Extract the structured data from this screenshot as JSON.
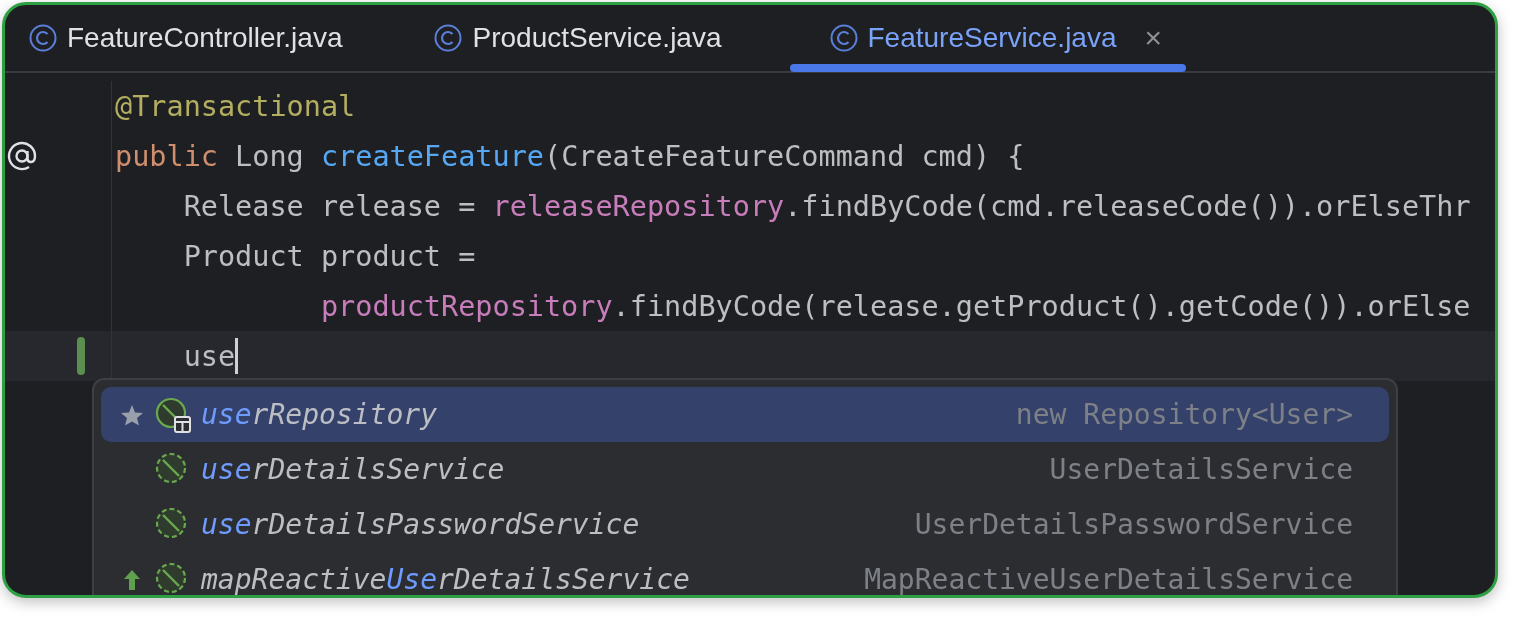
{
  "tabs": [
    {
      "label": "FeatureController.java",
      "selected": false
    },
    {
      "label": "ProductService.java",
      "selected": false
    },
    {
      "label": "FeatureService.java",
      "selected": true,
      "close": "×"
    }
  ],
  "editor": {
    "lines": [
      {
        "annotation_icon": false,
        "changed": false,
        "current": false,
        "caret": false,
        "tokens": [
          {
            "kind": "annotation",
            "text": "@Transactional"
          }
        ]
      },
      {
        "annotation_icon": true,
        "changed": false,
        "current": false,
        "caret": false,
        "tokens": [
          {
            "kind": "keyword",
            "text": "public"
          },
          {
            "kind": "plain",
            "text": " Long "
          },
          {
            "kind": "method",
            "text": "createFeature"
          },
          {
            "kind": "plain",
            "text": "(CreateFeatureCommand cmd) {"
          }
        ]
      },
      {
        "annotation_icon": false,
        "changed": false,
        "current": false,
        "caret": false,
        "tokens": [
          {
            "kind": "plain",
            "text": "    Release release = "
          },
          {
            "kind": "field",
            "text": "releaseRepository"
          },
          {
            "kind": "plain",
            "text": ".findByCode(cmd.releaseCode()).orElseThr"
          }
        ]
      },
      {
        "annotation_icon": false,
        "changed": false,
        "current": false,
        "caret": false,
        "tokens": [
          {
            "kind": "plain",
            "text": "    Product product ="
          }
        ]
      },
      {
        "annotation_icon": false,
        "changed": false,
        "current": false,
        "caret": false,
        "tokens": [
          {
            "kind": "field",
            "text": "            productRepository"
          },
          {
            "kind": "plain",
            "text": ".findByCode(release.getProduct().getCode()).orElse"
          }
        ]
      },
      {
        "annotation_icon": false,
        "changed": true,
        "current": true,
        "caret": true,
        "tokens": [
          {
            "kind": "plain",
            "text": "    use"
          }
        ]
      }
    ]
  },
  "completion": {
    "items": [
      {
        "starred": true,
        "promoted": false,
        "badge": true,
        "selected": true,
        "name_parts": [
          {
            "text": "use",
            "match": true
          },
          {
            "text": "rRepository",
            "match": false
          }
        ],
        "type": "new Repository<User>"
      },
      {
        "starred": false,
        "promoted": false,
        "badge": false,
        "selected": false,
        "name_parts": [
          {
            "text": "use",
            "match": true
          },
          {
            "text": "rDetailsService",
            "match": false
          }
        ],
        "type": "UserDetailsService"
      },
      {
        "starred": false,
        "promoted": false,
        "badge": false,
        "selected": false,
        "name_parts": [
          {
            "text": "use",
            "match": true
          },
          {
            "text": "rDetailsPasswordService",
            "match": false
          }
        ],
        "type": "UserDetailsPasswordService"
      },
      {
        "starred": false,
        "promoted": true,
        "badge": false,
        "selected": false,
        "name_parts": [
          {
            "text": "mapReactive",
            "match": false
          },
          {
            "text": "Use",
            "match": true
          },
          {
            "text": "rDetailsService",
            "match": false
          }
        ],
        "type": "MapReactiveUserDetailsService"
      }
    ]
  }
}
